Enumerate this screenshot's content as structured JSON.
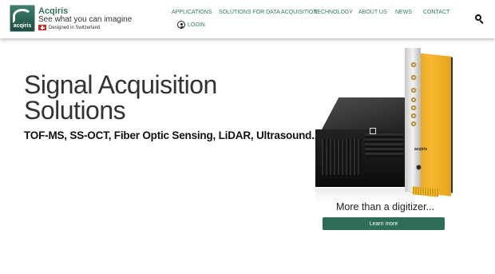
{
  "header": {
    "brand": "Acqiris",
    "logo_text": "acqiris",
    "tagline": "See what you can imagine",
    "swiss_label": "Designed in Switzerland",
    "nav": [
      {
        "label": "APPLICATIONS"
      },
      {
        "label": "SOLUTIONS FOR DATA ACQUISITION"
      },
      {
        "label": "TECHNOLOGY"
      },
      {
        "label": "ABOUT US"
      },
      {
        "label": "NEWS"
      },
      {
        "label": "CONTACT"
      }
    ],
    "login_label": "LOGIN",
    "icons": {
      "search": "search-icon",
      "login": "user-circle-icon",
      "flag": "swiss-flag-icon"
    }
  },
  "hero": {
    "title_line1": "Signal Acquisition",
    "title_line2": "Solutions",
    "subtitle": "TOF-MS, SS-OCT, Fiber Optic Sensing, LiDAR, Ultrasound...",
    "caption": "More than a digitizer...",
    "cta_label": "Learn more",
    "card_brand": "acqiris"
  },
  "colors": {
    "brand_green": "#2f7a5c",
    "button_green": "#2e6e58",
    "card_orange": "#f2ad2a"
  }
}
